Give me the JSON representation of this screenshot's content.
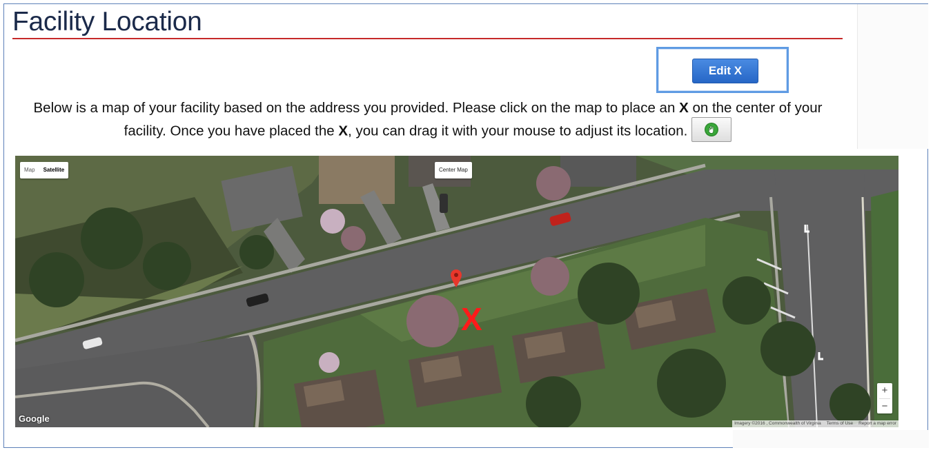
{
  "page": {
    "title": "Facility Location",
    "edit_button_label": "Edit X",
    "instructions": {
      "part1": "Below is a map of your facility based on the address you provided. Please click on the map to place an ",
      "bold1": "X",
      "part2": " on the center of your facility. Once you have placed the ",
      "bold2": "X",
      "part3": ", you can drag it with your mouse to adjust its location."
    },
    "hand_tool_icon": "hand-icon"
  },
  "map": {
    "type_options": [
      "Map",
      "Satellite"
    ],
    "active_type": "Satellite",
    "center_map_label": "Center Map",
    "zoom_in": "+",
    "zoom_out": "−",
    "logo": "Google",
    "attribution": "Imagery ©2016 , Commonwealth of Virginia",
    "terms": "Terms of Use",
    "report": "Report a map error",
    "placed_marker": "X",
    "pin_icon": "map-pin-icon"
  },
  "colors": {
    "heading": "#1b2a4a",
    "rule": "#c62828",
    "button": "#2f72d3",
    "marker": "#ff1a1a"
  }
}
